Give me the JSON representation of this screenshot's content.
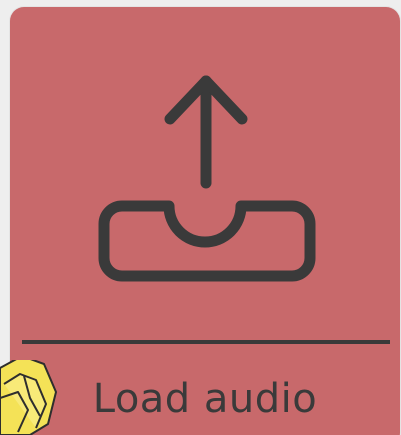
{
  "tile": {
    "label": "Load audio",
    "icon": "upload-icon",
    "background_color": "#c8696b",
    "ink_color": "#3a3a3a"
  },
  "overlay": {
    "icon": "yellow-sticker-icon",
    "color": "#f5e45a"
  }
}
